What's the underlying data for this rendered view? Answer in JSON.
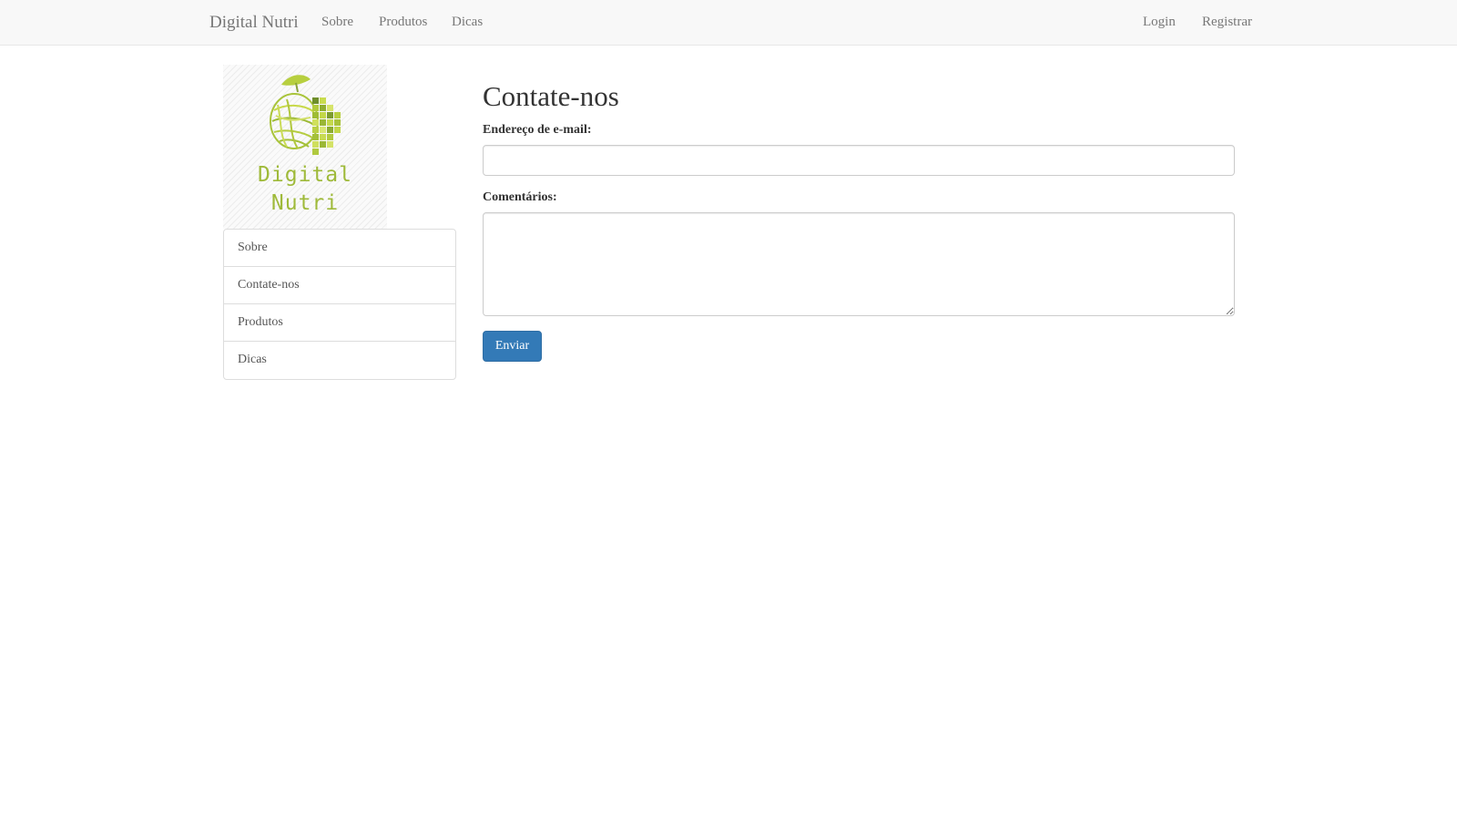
{
  "navbar": {
    "brand": "Digital Nutri",
    "links": [
      {
        "label": "Sobre"
      },
      {
        "label": "Produtos"
      },
      {
        "label": "Dicas"
      }
    ],
    "right_links": [
      {
        "label": "Login"
      },
      {
        "label": "Registrar"
      }
    ]
  },
  "logo": {
    "line1": "Digital",
    "line2": "Nutri",
    "icon": "apple-pixel-icon",
    "color": "#9fba3a"
  },
  "sidebar": {
    "items": [
      {
        "label": "Sobre"
      },
      {
        "label": "Contate-nos"
      },
      {
        "label": "Produtos"
      },
      {
        "label": "Dicas"
      }
    ]
  },
  "main": {
    "title": "Contate-nos",
    "email_label": "Endereço de e-mail:",
    "email_value": "",
    "comments_label": "Comentários:",
    "comments_value": "",
    "submit_label": "Enviar"
  },
  "colors": {
    "primary_button": "#337ab7",
    "navbar_bg": "#f8f8f8"
  }
}
